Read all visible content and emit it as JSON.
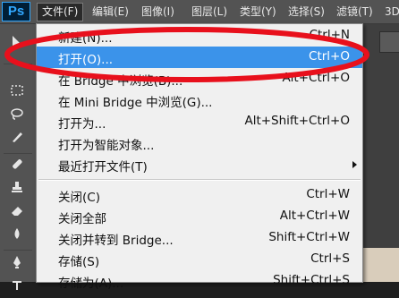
{
  "app": {
    "logo": "Ps"
  },
  "menubar": {
    "items": [
      "文件(F)",
      "编辑(E)",
      "图像(I)",
      "图层(L)",
      "类型(Y)",
      "选择(S)",
      "滤镜(T)",
      "3D"
    ]
  },
  "file_menu": {
    "new": {
      "label": "新建(N)...",
      "shortcut": "Ctrl+N"
    },
    "open": {
      "label": "打开(O)...",
      "shortcut": "Ctrl+O"
    },
    "browse_bridge": {
      "label": "在 Bridge 中浏览(B)...",
      "shortcut": "Alt+Ctrl+O"
    },
    "browse_mini_bridge": {
      "label": "在 Mini Bridge 中浏览(G)...",
      "shortcut": ""
    },
    "open_as": {
      "label": "打开为...",
      "shortcut": "Alt+Shift+Ctrl+O"
    },
    "open_as_smart": {
      "label": "打开为智能对象...",
      "shortcut": ""
    },
    "recent": {
      "label": "最近打开文件(T)",
      "shortcut": ""
    },
    "close": {
      "label": "关闭(C)",
      "shortcut": "Ctrl+W"
    },
    "close_all": {
      "label": "关闭全部",
      "shortcut": "Alt+Ctrl+W"
    },
    "close_to_bridge": {
      "label": "关闭并转到 Bridge...",
      "shortcut": "Shift+Ctrl+W"
    },
    "save": {
      "label": "存储(S)",
      "shortcut": "Ctrl+S"
    },
    "save_as": {
      "label": "存储为(A)...",
      "shortcut": "Shift+Ctrl+S"
    }
  },
  "colors": {
    "highlight": "#3b93ea",
    "annotation": "#e8101c",
    "menubar": "#535353"
  },
  "icons": [
    "move-icon",
    "marquee-icon",
    "lasso-icon",
    "brush-icon",
    "healing-icon",
    "stamp-icon",
    "eraser-icon",
    "blur-icon",
    "pen-icon"
  ]
}
